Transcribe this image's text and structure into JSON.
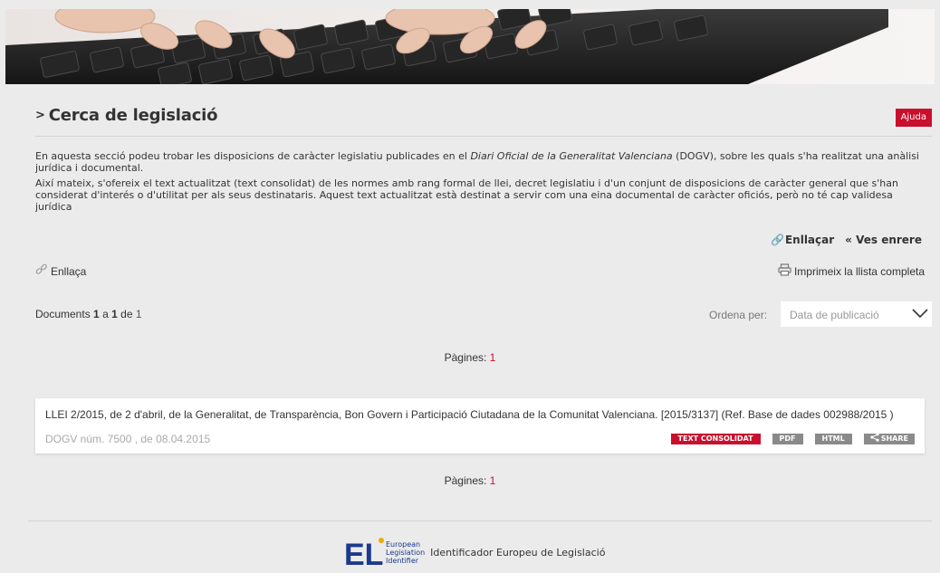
{
  "header": {
    "title_prefix": ">",
    "title": "Cerca de legislació",
    "help_label": "Ajuda"
  },
  "intro": {
    "p1_before": "En aquesta secció podeu trobar les disposicions de caràcter legislatiu publicades en el ",
    "p1_italic": "Diari Oficial de la Generalitat Valenciana",
    "p1_after": " (DOGV), sobre les quals s'ha realitzat una anàlisi jurídica i documental.",
    "p2": "Així mateix, s'ofereix el text actualitzat (text consolidat) de les normes amb rang formal de llei, decret legislatiu i d'un conjunt de disposicions de caràcter general que s'han considerat d'interés o d'utilitat per als seus destinataris. Aquest text actualitzat està destinat a servir com una eina documental de caràcter oficiós, però no té cap validesa jurídica"
  },
  "links": {
    "link_label": "Enllaçar",
    "back_label": "« Ves enrere"
  },
  "actions": {
    "link_label": "Enllaça",
    "print_label": "Imprimeix la llista completa"
  },
  "results_info": {
    "prefix": "Documents",
    "from": "1",
    "a": "a",
    "to": "1",
    "de": "de",
    "total": "1"
  },
  "sort": {
    "label": "Ordena per:",
    "selected": "Data de publicació"
  },
  "pagination": {
    "label": "Pàgines:",
    "current": "1"
  },
  "results": [
    {
      "title": "LLEI 2/2015, de 2 d'abril, de la Generalitat, de Transparència, Bon Govern i Participació Ciutadana de la Comunitat Valenciana. [2015/3137] (Ref. Base de dades 002988/2015 )",
      "meta": "DOGV núm. 7500 , de 08.04.2015",
      "badges": {
        "consolidated": "TEXT CONSOLIDAT",
        "pdf": "PDF",
        "html": "HTML",
        "share": "SHARE"
      }
    }
  ],
  "footer": {
    "eli_logo": "ELI",
    "eli_line1": "European",
    "eli_line2": "Legislation",
    "eli_line3": "Identifier",
    "eli_text": "Identificador Europeu de Legislació"
  },
  "colors": {
    "accent": "#c8102e",
    "eli_blue": "#1b3a8c",
    "eli_gold": "#f2a900"
  },
  "icons": [
    "link-icon",
    "print-icon",
    "chevron-down-icon",
    "share-icon"
  ]
}
